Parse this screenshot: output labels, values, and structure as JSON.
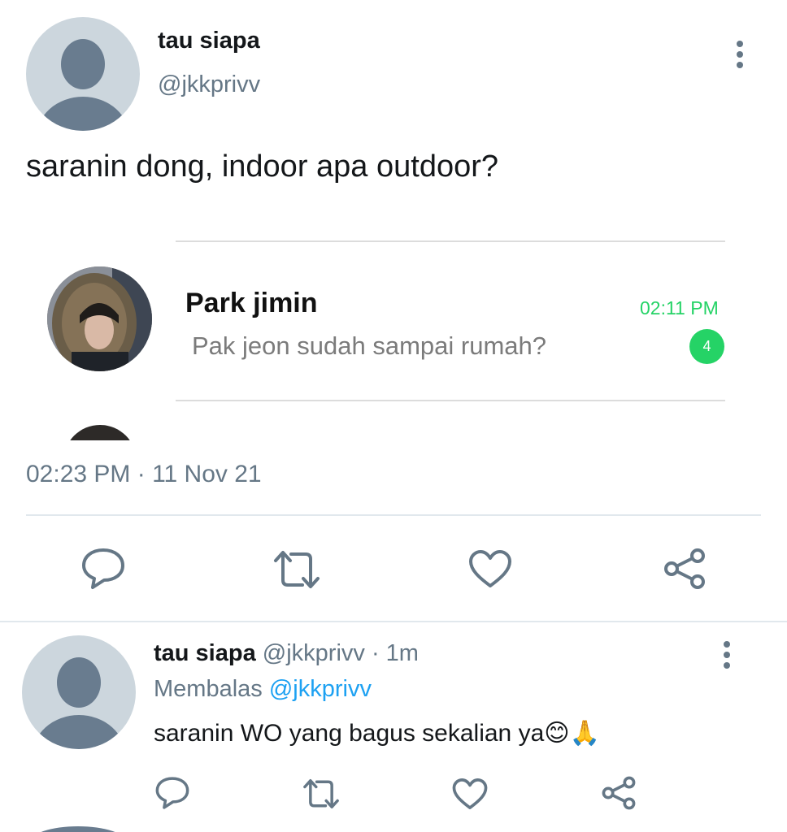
{
  "tweet": {
    "display_name": "tau siapa",
    "handle": "@jkkprivv",
    "text": "saranin dong, indoor apa outdoor?",
    "timestamp": "02:23 PM · 11 Nov 21"
  },
  "attached_image": {
    "chat_name": "Park jimin",
    "chat_message": "Pak jeon sudah sampai rumah?",
    "chat_time": "02:11 PM",
    "unread_count": "4",
    "accent_color": "#25d366"
  },
  "actions": [
    {
      "icon": "reply-icon"
    },
    {
      "icon": "retweet-icon"
    },
    {
      "icon": "like-icon"
    },
    {
      "icon": "share-icon"
    }
  ],
  "reply": {
    "display_name": "tau siapa",
    "meta": "@jkkprivv · 1m",
    "replying_prefix": "Membalas",
    "replying_handle": "@jkkprivv",
    "text": "saranin WO yang bagus sekalian ya😊🙏"
  },
  "colors": {
    "text": "#14171a",
    "muted": "#657786",
    "link": "#1da1f2",
    "divider": "#e1e8ed"
  }
}
